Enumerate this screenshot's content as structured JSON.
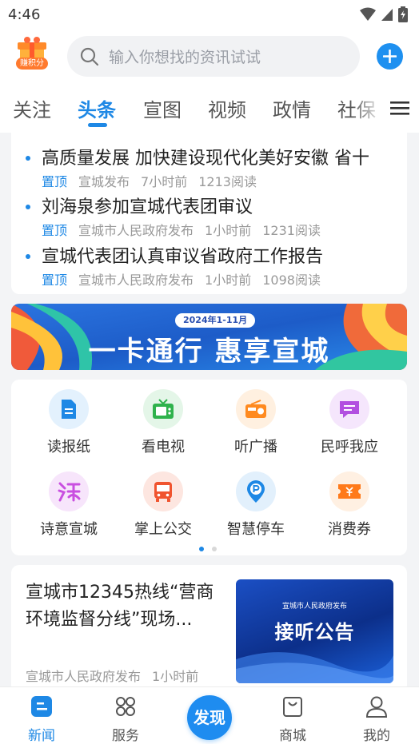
{
  "status_bar": {
    "time": "4:46"
  },
  "header": {
    "points_label": "赚积分",
    "search_placeholder": "输入你想找的资讯试试"
  },
  "tabs": [
    {
      "label": "关注",
      "active": false
    },
    {
      "label": "头条",
      "active": true
    },
    {
      "label": "宣图",
      "active": false
    },
    {
      "label": "视频",
      "active": false
    },
    {
      "label": "政情",
      "active": false
    },
    {
      "label": "社保",
      "active": false
    }
  ],
  "headlines": [
    {
      "title": "高质量发展 加快建设现代化美好安徽 省十",
      "pin": "置顶",
      "source": "宣城发布",
      "time": "7小时前",
      "reads": "1213阅读"
    },
    {
      "title": "刘海泉参加宣城代表团审议",
      "pin": "置顶",
      "source": "宣城市人民政府发布",
      "time": "1小时前",
      "reads": "1231阅读"
    },
    {
      "title": "宣城代表团认真审议省政府工作报告",
      "pin": "置顶",
      "source": "宣城市人民政府发布",
      "time": "1小时前",
      "reads": "1098阅读"
    }
  ],
  "banner": {
    "tag": "2024年1-11月",
    "title": "一卡通行 惠享宣城"
  },
  "services": [
    {
      "label": "读报纸",
      "icon": "document-icon",
      "color": "#1e88e5",
      "bg": "#e3f1fd"
    },
    {
      "label": "看电视",
      "icon": "tv-icon",
      "color": "#2fb24c",
      "bg": "#e4f6e8"
    },
    {
      "label": "听广播",
      "icon": "radio-icon",
      "color": "#ff8a1f",
      "bg": "#fff0e0"
    },
    {
      "label": "民呼我应",
      "icon": "chat-icon",
      "color": "#b24fe0",
      "bg": "#f5e6fc"
    },
    {
      "label": "诗意宣城",
      "icon": "poetry-icon",
      "color": "#c94fe0",
      "bg": "#f7e5fb"
    },
    {
      "label": "掌上公交",
      "icon": "bus-icon",
      "color": "#f0542f",
      "bg": "#fde6e0"
    },
    {
      "label": "智慧停车",
      "icon": "parking-icon",
      "color": "#1e88e5",
      "bg": "#e2f0fc"
    },
    {
      "label": "消费券",
      "icon": "coupon-icon",
      "color": "#ff7a1a",
      "bg": "#fff0e2"
    }
  ],
  "article": {
    "title": "宣城市12345热线“营商环境监督分线”现场...",
    "source": "宣城市人民政府发布",
    "time": "1小时前",
    "thumb_issuer": "宣城市人民政府发布",
    "thumb_title": "接听公告"
  },
  "bottom_nav": {
    "news": "新闻",
    "service": "服务",
    "discover": "发现",
    "mall": "商城",
    "mine": "我的"
  }
}
